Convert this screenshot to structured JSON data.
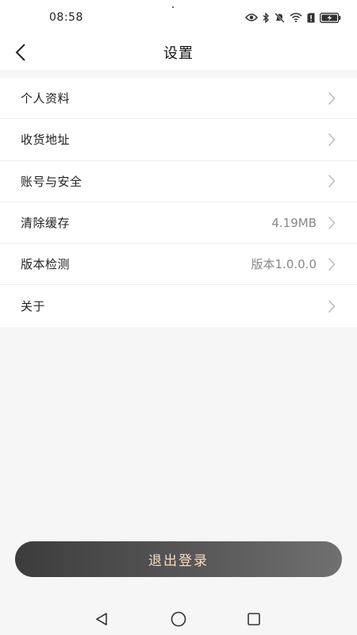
{
  "status_bar": {
    "time": "08:58",
    "icons": [
      "eye-icon",
      "bluetooth-icon",
      "mute-icon",
      "wifi-icon",
      "sim-alert-icon",
      "battery-charging-icon"
    ]
  },
  "header": {
    "title": "设置",
    "back_icon": "chevron-left-icon"
  },
  "settings": {
    "items": [
      {
        "label": "个人资料",
        "value": ""
      },
      {
        "label": "收货地址",
        "value": ""
      },
      {
        "label": "账号与安全",
        "value": ""
      },
      {
        "label": "清除缓存",
        "value": "4.19MB"
      },
      {
        "label": "版本检测",
        "value": "版本1.0.0.0"
      },
      {
        "label": "关于",
        "value": ""
      }
    ]
  },
  "logout": {
    "label": "退出登录"
  },
  "nav_bar": {
    "icons": [
      "back-triangle-icon",
      "home-circle-icon",
      "recents-square-icon"
    ]
  },
  "colors": {
    "logout_text": "#f3dcc0",
    "logout_bg_start": "#3c3c3c",
    "logout_bg_end": "#707070",
    "page_bg": "#f6f6f6"
  }
}
